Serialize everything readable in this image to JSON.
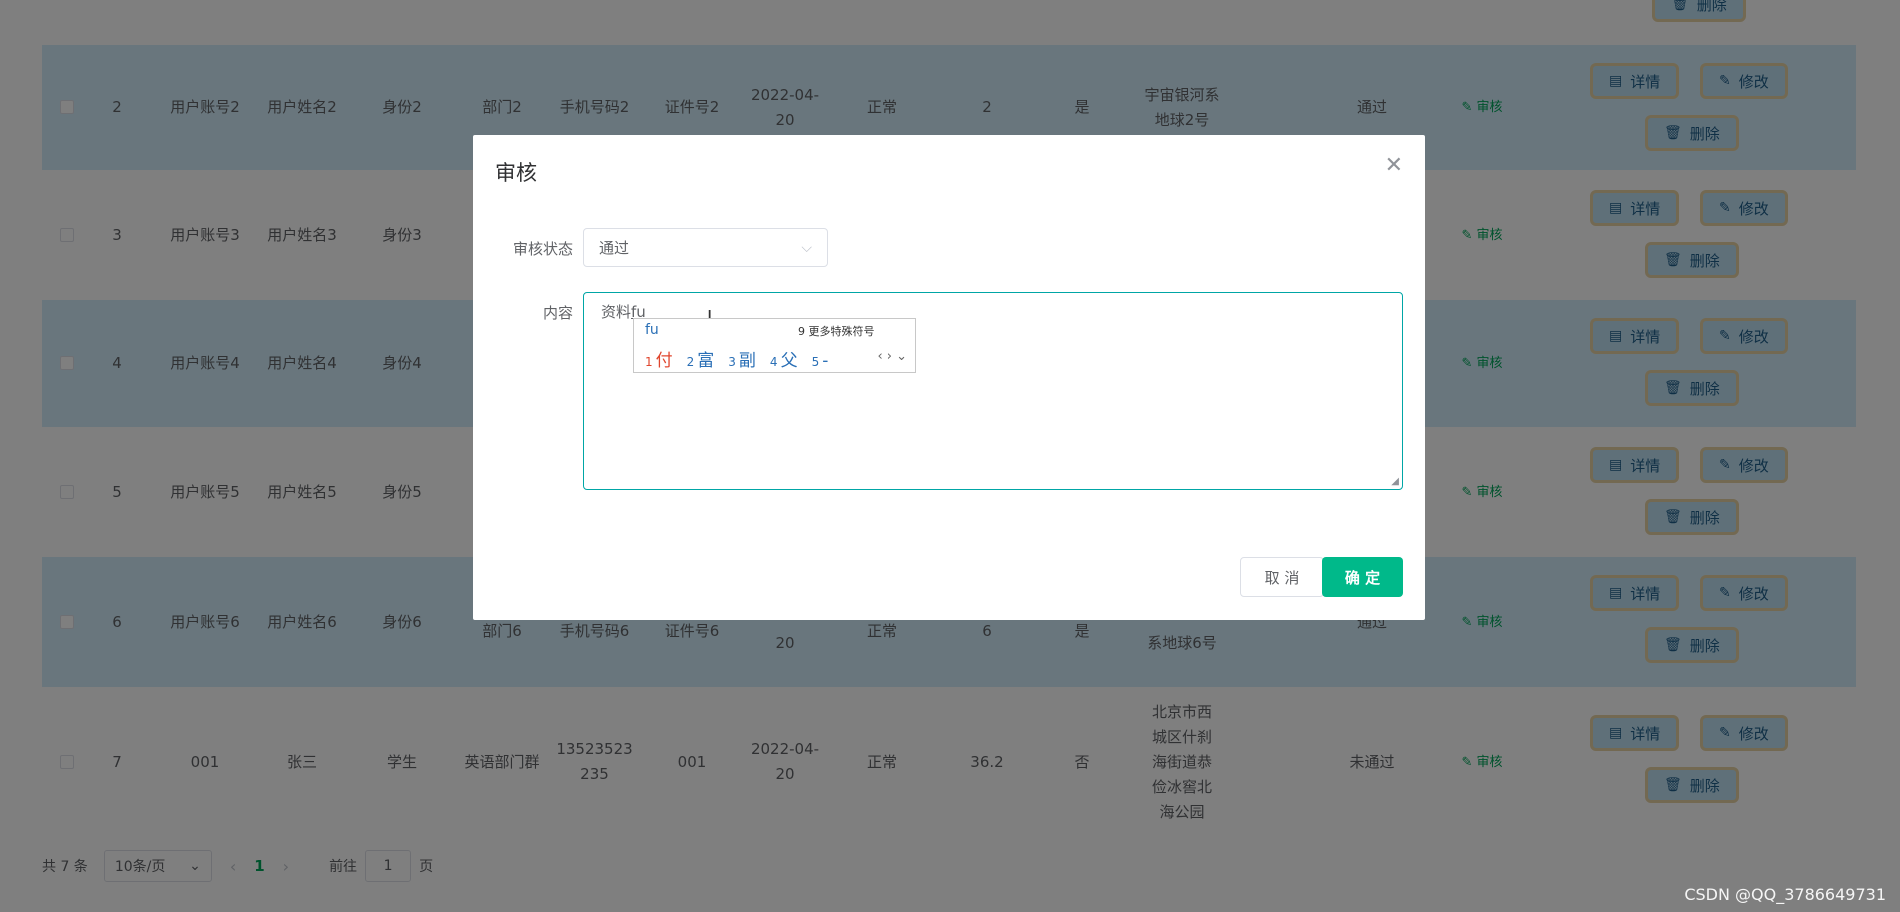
{
  "table": {
    "rows": [
      {
        "idx": "2",
        "account": "用户账号2",
        "name": "用户姓名2",
        "identity": "身份2",
        "dept": "部门2",
        "phone": "手机号码2",
        "cert": "证件号2",
        "date": "2022-04-20",
        "status": "正常",
        "num": "2",
        "flag": "是",
        "addr": "宇宙银河系地球2号",
        "result": "通过"
      },
      {
        "idx": "3",
        "account": "用户账号3",
        "name": "用户姓名3",
        "identity": "身份3",
        "dept": "",
        "phone": "",
        "cert": "",
        "date": "",
        "status": "",
        "num": "",
        "flag": "",
        "addr": "",
        "result": ""
      },
      {
        "idx": "4",
        "account": "用户账号4",
        "name": "用户姓名4",
        "identity": "身份4",
        "dept": "",
        "phone": "",
        "cert": "",
        "date": "",
        "status": "",
        "num": "",
        "flag": "",
        "addr": "",
        "result": ""
      },
      {
        "idx": "5",
        "account": "用户账号5",
        "name": "用户姓名5",
        "identity": "身份5",
        "dept": "",
        "phone": "",
        "cert": "",
        "date": "",
        "status": "",
        "num": "",
        "flag": "",
        "addr": "",
        "result": ""
      },
      {
        "idx": "6",
        "account": "用户账号6",
        "name": "用户姓名6",
        "identity": "身份6",
        "dept": "部门6",
        "phone": "手机号码6",
        "cert": "证件号6",
        "date": "20",
        "status": "正常",
        "num": "6",
        "flag": "是",
        "addr": "系地球6号",
        "result": "通过"
      },
      {
        "idx": "7",
        "account": "001",
        "name": "张三",
        "identity": "学生",
        "dept": "英语部门群",
        "phone": "13523523235",
        "cert": "001",
        "date": "2022-04-20",
        "status": "正常",
        "num": "36.2",
        "flag": "否",
        "addr": "北京市西城区什刹海街道恭俭冰窖北海公园",
        "result": "未通过"
      }
    ],
    "actions": {
      "detail": "详情",
      "edit": "修改",
      "delete": "删除",
      "audit": "审核"
    }
  },
  "pagination": {
    "total": "共 7 条",
    "page_size": "10条/页",
    "current_page": "1",
    "goto_prefix": "前往",
    "goto_value": "1",
    "goto_suffix": "页"
  },
  "dialog": {
    "title": "审核",
    "status_label": "审核状态",
    "status_value": "通过",
    "content_label": "内容",
    "content_text": "资料",
    "content_typing": "fu",
    "cancel": "取 消",
    "confirm": "确 定"
  },
  "ime": {
    "composition": "fu",
    "more": "9 更多特殊符号",
    "candidates": [
      {
        "n": "1",
        "c": "付"
      },
      {
        "n": "2",
        "c": "富"
      },
      {
        "n": "3",
        "c": "副"
      },
      {
        "n": "4",
        "c": "父"
      },
      {
        "n": "5",
        "c": "-"
      }
    ]
  },
  "watermark": "CSDN @QQ_3786649731"
}
